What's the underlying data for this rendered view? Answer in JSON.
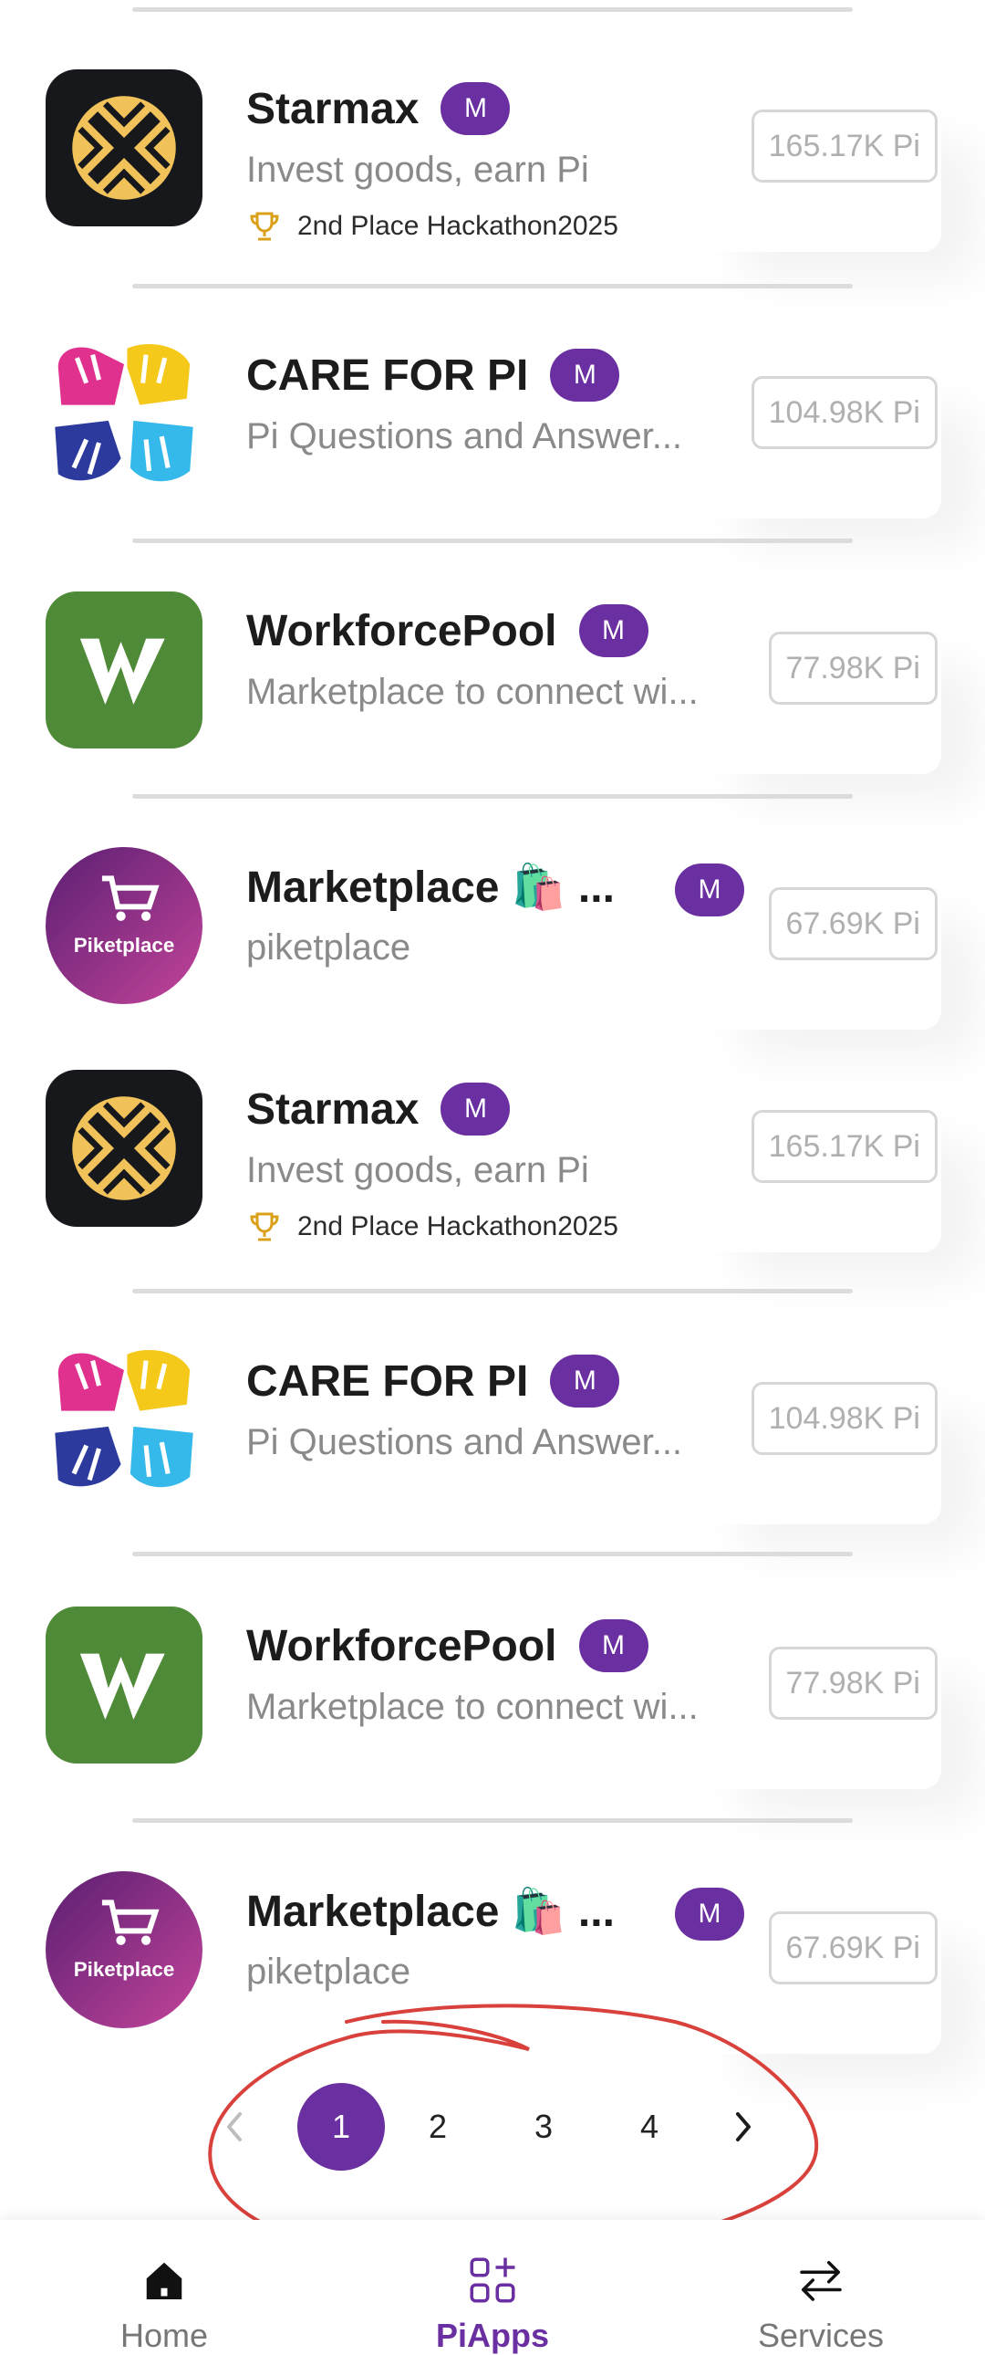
{
  "apps": [
    {
      "name": "Starmax",
      "badge": "M",
      "description": "Invest goods, earn Pi",
      "award": "2nd Place Hackathon2025",
      "pi": "165.17K Pi",
      "icon": "starmax-logo-icon"
    },
    {
      "name": "CARE FOR PI",
      "badge": "M",
      "description": "Pi Questions and Answer...",
      "pi": "104.98K Pi",
      "icon": "care-for-pi-hands-icon"
    },
    {
      "name": "WorkforcePool",
      "badge": "M",
      "description": "Marketplace to connect wi...",
      "pi": "77.98K Pi",
      "icon": "workforcepool-w-icon"
    },
    {
      "name": "Marketplace 🛍️ ...",
      "badge": "M",
      "description": "piketplace",
      "pi": "67.69K Pi",
      "icon": "piketplace-cart-icon",
      "icon_text": "Piketplace"
    },
    {
      "name": "Starmax",
      "badge": "M",
      "description": "Invest goods, earn Pi",
      "award": "2nd Place Hackathon2025",
      "pi": "165.17K Pi",
      "icon": "starmax-logo-icon"
    },
    {
      "name": "CARE FOR PI",
      "badge": "M",
      "description": "Pi Questions and Answer...",
      "pi": "104.98K Pi",
      "icon": "care-for-pi-hands-icon"
    },
    {
      "name": "WorkforcePool",
      "badge": "M",
      "description": "Marketplace to connect wi...",
      "pi": "77.98K Pi",
      "icon": "workforcepool-w-icon"
    },
    {
      "name": "Marketplace 🛍️ ...",
      "badge": "M",
      "description": "piketplace",
      "pi": "67.69K Pi",
      "icon": "piketplace-cart-icon",
      "icon_text": "Piketplace"
    }
  ],
  "pagination": {
    "pages": [
      "1",
      "2",
      "3",
      "4"
    ],
    "current": "1"
  },
  "bottom_nav": {
    "items": [
      {
        "label": "Home",
        "icon": "home-icon"
      },
      {
        "label": "PiApps",
        "icon": "apps-grid-icon",
        "active": true
      },
      {
        "label": "Services",
        "icon": "swap-arrows-icon"
      }
    ]
  },
  "colors": {
    "accent": "#6a2fa0",
    "annotation": "#d8413c",
    "starmax_bg": "#17181c",
    "starmax_mark": "#f2c25a",
    "workforce_green": "#4e8a38"
  }
}
